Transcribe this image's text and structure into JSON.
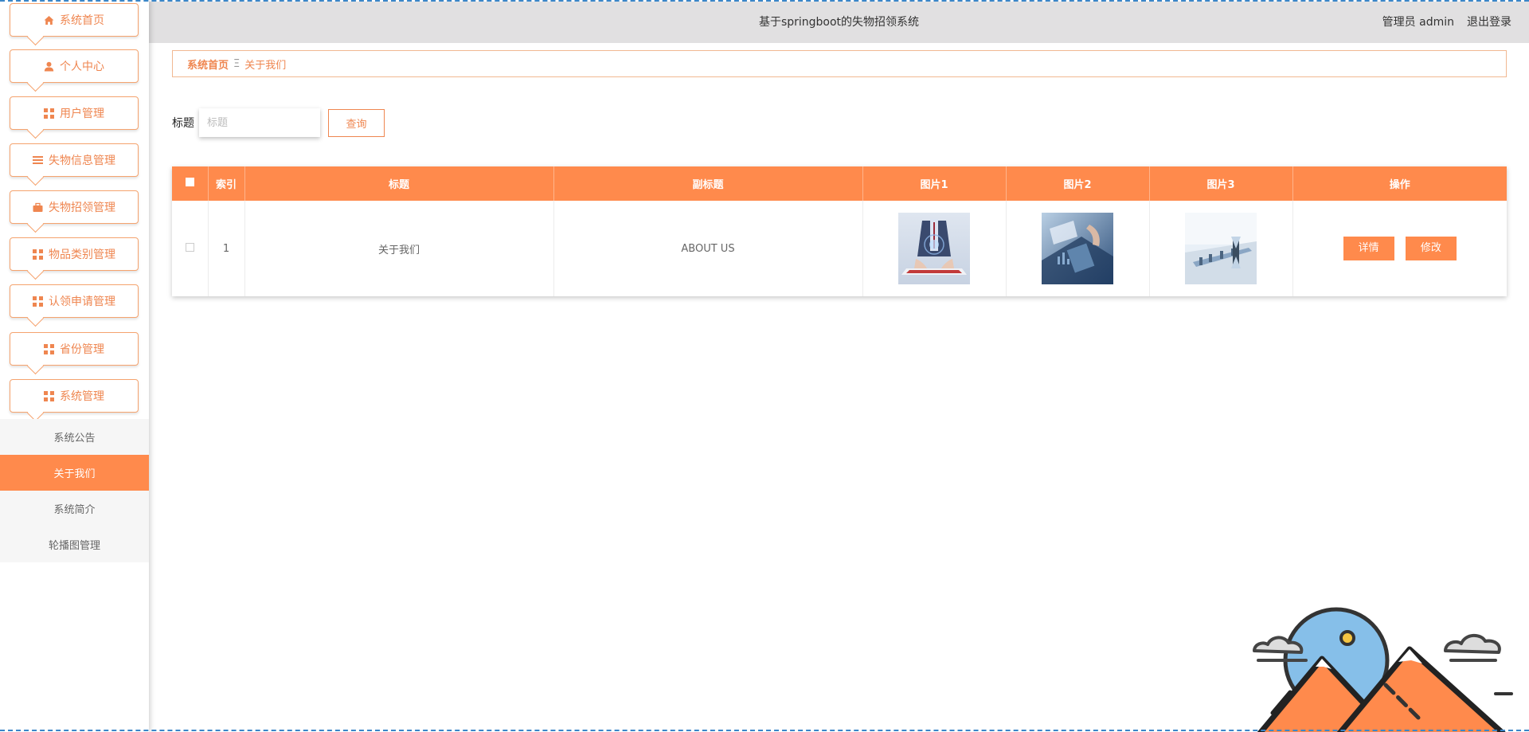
{
  "app": {
    "title": "基于springboot的失物招领系统",
    "user_label": "管理员 admin",
    "logout_label": "退出登录"
  },
  "sidebar": {
    "items": [
      {
        "label": "系统首页",
        "icon": "home-icon"
      },
      {
        "label": "个人中心",
        "icon": "user-icon"
      },
      {
        "label": "用户管理",
        "icon": "grid-icon"
      },
      {
        "label": "失物信息管理",
        "icon": "list-icon"
      },
      {
        "label": "失物招领管理",
        "icon": "briefcase-icon"
      },
      {
        "label": "物品类别管理",
        "icon": "grid-icon"
      },
      {
        "label": "认领申请管理",
        "icon": "grid-icon"
      },
      {
        "label": "省份管理",
        "icon": "grid-icon"
      },
      {
        "label": "系统管理",
        "icon": "grid-icon"
      }
    ],
    "submenu": [
      {
        "label": "系统公告",
        "active": false
      },
      {
        "label": "关于我们",
        "active": true
      },
      {
        "label": "系统简介",
        "active": false
      },
      {
        "label": "轮播图管理",
        "active": false
      }
    ]
  },
  "breadcrumb": {
    "home": "系统首页",
    "separator": "Ξ",
    "current": "关于我们"
  },
  "search": {
    "label": "标题",
    "placeholder": "标题",
    "value": "",
    "button": "查询"
  },
  "table": {
    "headers": [
      "索引",
      "标题",
      "副标题",
      "图片1",
      "图片2",
      "图片3",
      "操作"
    ],
    "rows": [
      {
        "index": "1",
        "title": "关于我们",
        "subtitle": "ABOUT US"
      }
    ],
    "actions": {
      "detail": "详情",
      "edit": "修改"
    }
  },
  "colors": {
    "accent": "#ff8a4c",
    "accent_text": "#ef8650",
    "topbar_bg": "#e1e0e1"
  }
}
